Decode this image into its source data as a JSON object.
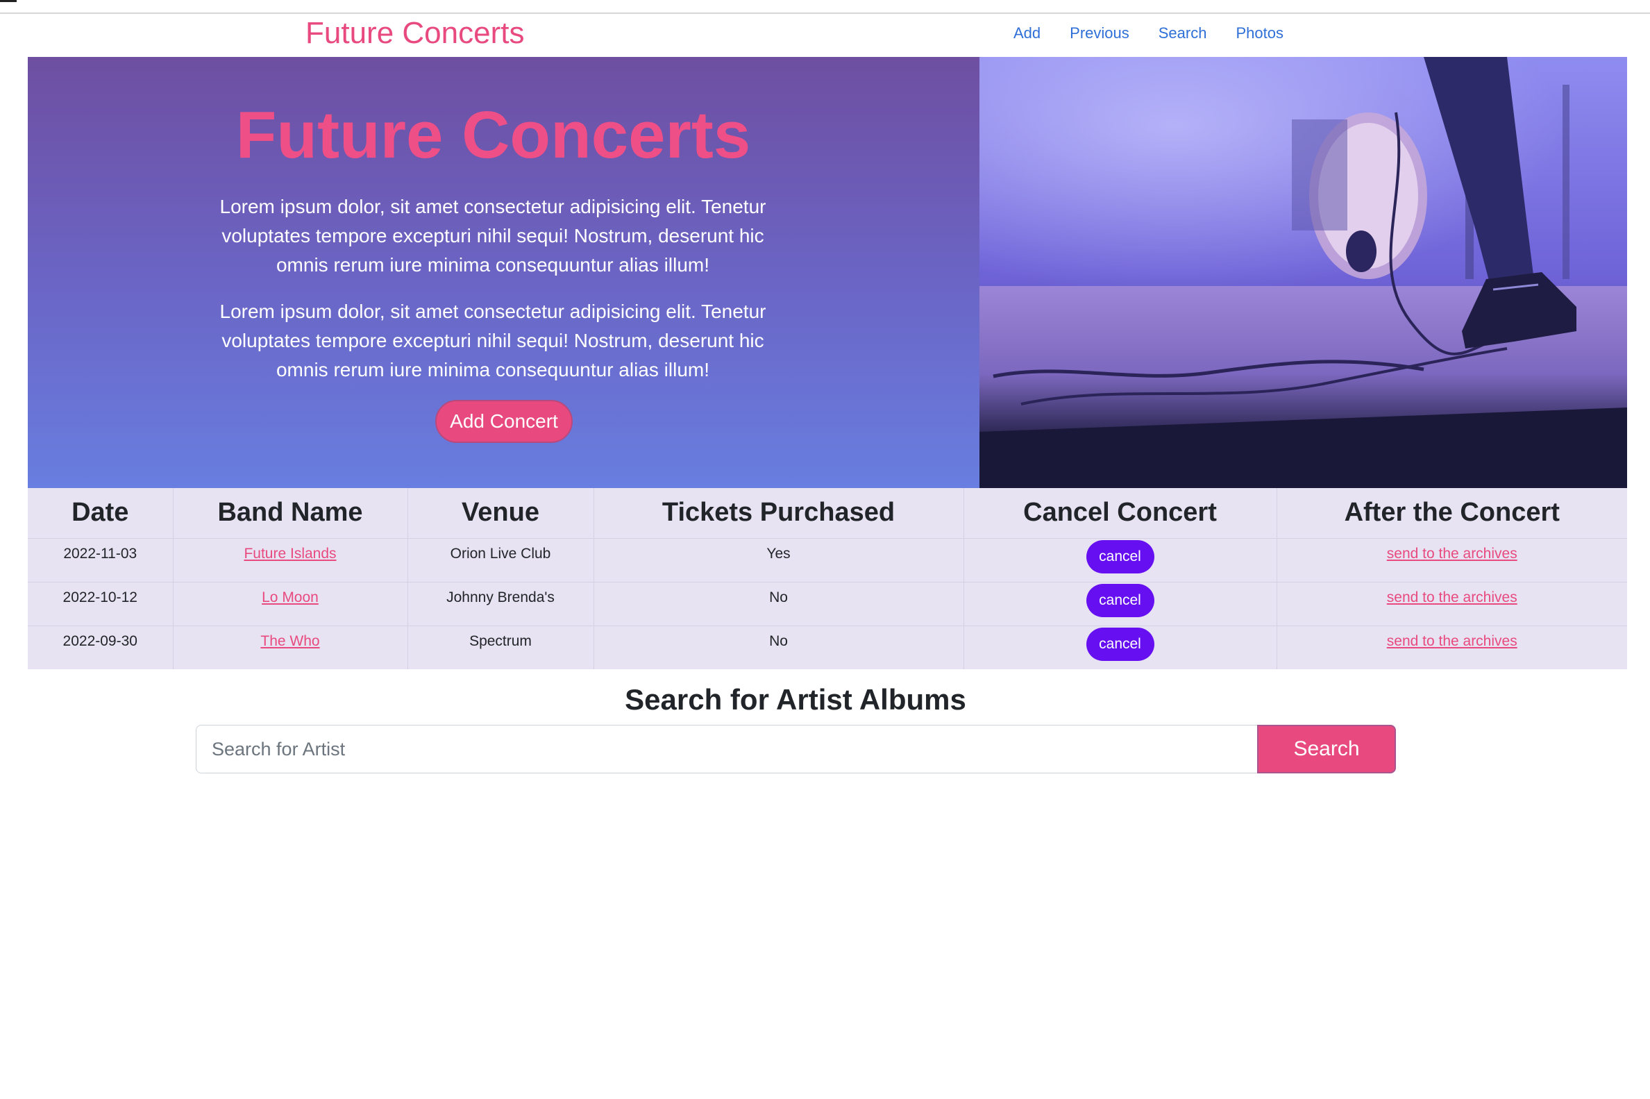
{
  "navbar": {
    "brand": "Future Concerts",
    "links": [
      "Add",
      "Previous",
      "Search",
      "Photos"
    ]
  },
  "hero": {
    "title": "Future Concerts",
    "paragraph1": "Lorem ipsum dolor, sit amet consectetur adipisicing elit. Tenetur voluptates tempore excepturi nihil sequi! Nostrum, deserunt hic omnis rerum iure minima consequuntur alias illum!",
    "paragraph2": "Lorem ipsum dolor, sit amet consectetur adipisicing elit. Tenetur voluptates tempore excepturi nihil sequi! Nostrum, deserunt hic omnis rerum iure minima consequuntur alias illum!",
    "button_label": "Add Concert",
    "image_icon": "stage-photo"
  },
  "table": {
    "headers": [
      "Date",
      "Band Name",
      "Venue",
      "Tickets Purchased",
      "Cancel Concert",
      "After the Concert"
    ],
    "rows": [
      {
        "date": "2022-11-03",
        "band": "Future Islands",
        "venue": "Orion Live Club",
        "tickets": "Yes",
        "cancel": "cancel",
        "after": "send to the archives"
      },
      {
        "date": "2022-10-12",
        "band": "Lo Moon",
        "venue": "Johnny Brenda's",
        "tickets": "No",
        "cancel": "cancel",
        "after": "send to the archives"
      },
      {
        "date": "2022-09-30",
        "band": "The Who",
        "venue": "Spectrum",
        "tickets": "No",
        "cancel": "cancel",
        "after": "send to the archives"
      }
    ]
  },
  "search": {
    "heading": "Search for Artist Albums",
    "placeholder": "Search for Artist",
    "value": "",
    "button_label": "Search"
  },
  "colors": {
    "brand_pink": "#e84a7f",
    "link_blue": "#2f6fd8",
    "cancel_purple": "#6610f2",
    "table_bg": "#e8e3f2"
  }
}
